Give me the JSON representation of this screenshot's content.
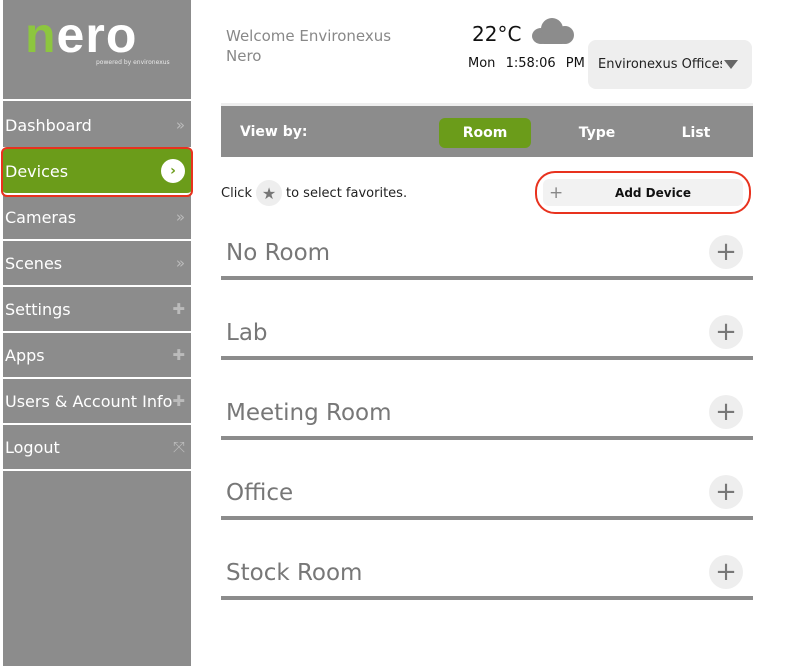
{
  "logo": {
    "text": "nero",
    "tagline": "powered by environexus",
    "accent": "#8dc63f"
  },
  "sidebar": {
    "items": [
      {
        "label": "Dashboard",
        "icon": "chevron-right-icon",
        "glyph": "»"
      },
      {
        "label": "Devices",
        "icon": "chevron-right-icon",
        "glyph": "›",
        "active": true
      },
      {
        "label": "Cameras",
        "icon": "chevron-right-icon",
        "glyph": "»"
      },
      {
        "label": "Scenes",
        "icon": "chevron-right-icon",
        "glyph": "»"
      },
      {
        "label": "Settings",
        "icon": "plus-icon",
        "glyph": "✚"
      },
      {
        "label": "Apps",
        "icon": "plus-icon",
        "glyph": "✚"
      },
      {
        "label": "Users & Account Info",
        "icon": "plus-icon",
        "glyph": "✚"
      },
      {
        "label": "Logout",
        "icon": "expand-icon",
        "glyph": "⤧"
      }
    ]
  },
  "header": {
    "welcome": "Welcome Environexus Nero",
    "temperature": "22°C",
    "weather_icon": "cloud-icon",
    "day": "Mon",
    "time": "1:58:06 PM",
    "location": "Environexus Offices"
  },
  "view": {
    "label": "View by:",
    "tabs": [
      {
        "label": "Room",
        "active": true
      },
      {
        "label": "Type"
      },
      {
        "label": "List"
      }
    ]
  },
  "hint": {
    "before": "Click",
    "after": "to select favorites."
  },
  "add_device": {
    "plus": "+",
    "label": "Add Device"
  },
  "rooms": [
    {
      "name": "No Room"
    },
    {
      "name": "Lab"
    },
    {
      "name": "Meeting Room"
    },
    {
      "name": "Office"
    },
    {
      "name": "Stock Room"
    }
  ],
  "colors": {
    "active_green": "#6b9c1a",
    "sidebar_gray": "#8c8c8c",
    "highlight_red": "#e8321e"
  }
}
